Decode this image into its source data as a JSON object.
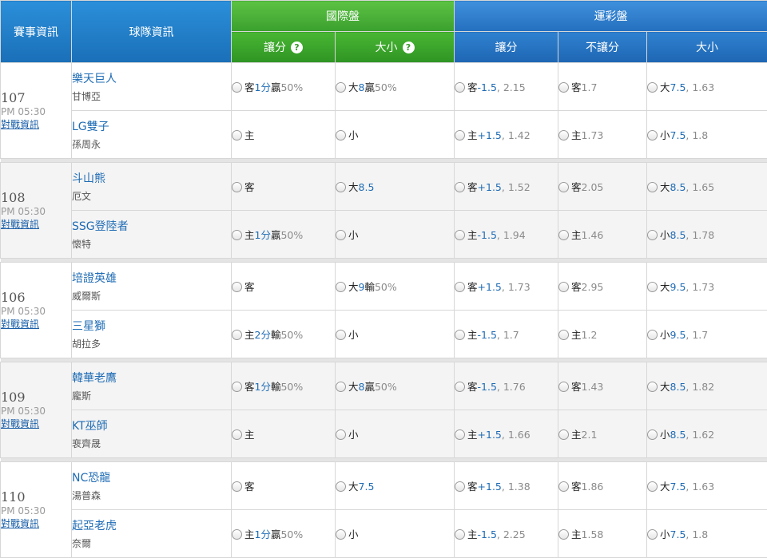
{
  "header": {
    "event_col": "賽事資訊",
    "team_col": "球隊資訊",
    "intl": "國際盤",
    "intl_spread": "讓分",
    "intl_total": "大小",
    "help_glyph": "?",
    "lottery": "運彩盤",
    "lt_spread": "讓分",
    "lt_ml": "不讓分",
    "lt_total": "大小"
  },
  "link_label": "對戰資訊",
  "games": [
    {
      "num": "107",
      "time": "PM 05:30",
      "away": {
        "name": "樂天巨人",
        "pitcher": "甘博亞"
      },
      "home": {
        "name": "LG雙子",
        "pitcher": "孫周永"
      },
      "intl_spread": [
        {
          "side": "客",
          "line": "1分",
          "res": "贏",
          "pct": "50%"
        },
        {
          "side": "主",
          "line": "",
          "res": "",
          "pct": ""
        }
      ],
      "intl_total": [
        {
          "side": "大",
          "line": "8",
          "res": "贏",
          "pct": "50%"
        },
        {
          "side": "小",
          "line": "",
          "res": "",
          "pct": ""
        }
      ],
      "lt_spread": [
        {
          "side": "客",
          "line": "-1.5",
          "price": ", 2.15"
        },
        {
          "side": "主",
          "line": "+1.5",
          "price": ", 1.42"
        }
      ],
      "lt_ml": [
        {
          "side": "客",
          "price": "1.7"
        },
        {
          "side": "主",
          "price": "1.73"
        }
      ],
      "lt_total": [
        {
          "side": "大",
          "line": "7.5",
          "price": ", 1.63"
        },
        {
          "side": "小",
          "line": "7.5",
          "price": ", 1.8"
        }
      ]
    },
    {
      "num": "108",
      "time": "PM 05:30",
      "away": {
        "name": "斗山熊",
        "pitcher": "厄文"
      },
      "home": {
        "name": "SSG登陸者",
        "pitcher": "懷特"
      },
      "intl_spread": [
        {
          "side": "客",
          "line": "",
          "res": "",
          "pct": ""
        },
        {
          "side": "主",
          "line": "1分",
          "res": "贏",
          "pct": "50%"
        }
      ],
      "intl_total": [
        {
          "side": "大",
          "line": "8.5",
          "res": "",
          "pct": ""
        },
        {
          "side": "小",
          "line": "",
          "res": "",
          "pct": ""
        }
      ],
      "lt_spread": [
        {
          "side": "客",
          "line": "+1.5",
          "price": ", 1.52"
        },
        {
          "side": "主",
          "line": "-1.5",
          "price": ", 1.94"
        }
      ],
      "lt_ml": [
        {
          "side": "客",
          "price": "2.05"
        },
        {
          "side": "主",
          "price": "1.46"
        }
      ],
      "lt_total": [
        {
          "side": "大",
          "line": "8.5",
          "price": ", 1.65"
        },
        {
          "side": "小",
          "line": "8.5",
          "price": ", 1.78"
        }
      ]
    },
    {
      "num": "106",
      "time": "PM 05:30",
      "away": {
        "name": "培證英雄",
        "pitcher": "威爾斯"
      },
      "home": {
        "name": "三星獅",
        "pitcher": "胡拉多"
      },
      "intl_spread": [
        {
          "side": "客",
          "line": "",
          "res": "",
          "pct": ""
        },
        {
          "side": "主",
          "line": "2分",
          "res": "輸",
          "pct": "50%"
        }
      ],
      "intl_total": [
        {
          "side": "大",
          "line": "9",
          "res": "輸",
          "pct": "50%"
        },
        {
          "side": "小",
          "line": "",
          "res": "",
          "pct": ""
        }
      ],
      "lt_spread": [
        {
          "side": "客",
          "line": "+1.5",
          "price": ", 1.73"
        },
        {
          "side": "主",
          "line": "-1.5",
          "price": ", 1.7"
        }
      ],
      "lt_ml": [
        {
          "side": "客",
          "price": "2.95"
        },
        {
          "side": "主",
          "price": "1.2"
        }
      ],
      "lt_total": [
        {
          "side": "大",
          "line": "9.5",
          "price": ", 1.73"
        },
        {
          "side": "小",
          "line": "9.5",
          "price": ", 1.7"
        }
      ]
    },
    {
      "num": "109",
      "time": "PM 05:30",
      "away": {
        "name": "韓華老鷹",
        "pitcher": "龐斯"
      },
      "home": {
        "name": "KT巫師",
        "pitcher": "裵齊晟"
      },
      "intl_spread": [
        {
          "side": "客",
          "line": "1分",
          "res": "輸",
          "pct": "50%"
        },
        {
          "side": "主",
          "line": "",
          "res": "",
          "pct": ""
        }
      ],
      "intl_total": [
        {
          "side": "大",
          "line": "8",
          "res": "贏",
          "pct": "50%"
        },
        {
          "side": "小",
          "line": "",
          "res": "",
          "pct": ""
        }
      ],
      "lt_spread": [
        {
          "side": "客",
          "line": "-1.5",
          "price": ", 1.76"
        },
        {
          "side": "主",
          "line": "+1.5",
          "price": ", 1.66"
        }
      ],
      "lt_ml": [
        {
          "side": "客",
          "price": "1.43"
        },
        {
          "side": "主",
          "price": "2.1"
        }
      ],
      "lt_total": [
        {
          "side": "大",
          "line": "8.5",
          "price": ", 1.82"
        },
        {
          "side": "小",
          "line": "8.5",
          "price": ", 1.62"
        }
      ]
    },
    {
      "num": "110",
      "time": "PM 05:30",
      "away": {
        "name": "NC恐龍",
        "pitcher": "湯普森"
      },
      "home": {
        "name": "起亞老虎",
        "pitcher": "奈爾"
      },
      "intl_spread": [
        {
          "side": "客",
          "line": "",
          "res": "",
          "pct": ""
        },
        {
          "side": "主",
          "line": "1分",
          "res": "贏",
          "pct": "50%"
        }
      ],
      "intl_total": [
        {
          "side": "大",
          "line": "7.5",
          "res": "",
          "pct": ""
        },
        {
          "side": "小",
          "line": "",
          "res": "",
          "pct": ""
        }
      ],
      "lt_spread": [
        {
          "side": "客",
          "line": "+1.5",
          "price": ", 1.38"
        },
        {
          "side": "主",
          "line": "-1.5",
          "price": ", 2.25"
        }
      ],
      "lt_ml": [
        {
          "side": "客",
          "price": "1.86"
        },
        {
          "side": "主",
          "price": "1.58"
        }
      ],
      "lt_total": [
        {
          "side": "大",
          "line": "7.5",
          "price": ", 1.63"
        },
        {
          "side": "小",
          "line": "7.5",
          "price": ", 1.8"
        }
      ]
    }
  ]
}
